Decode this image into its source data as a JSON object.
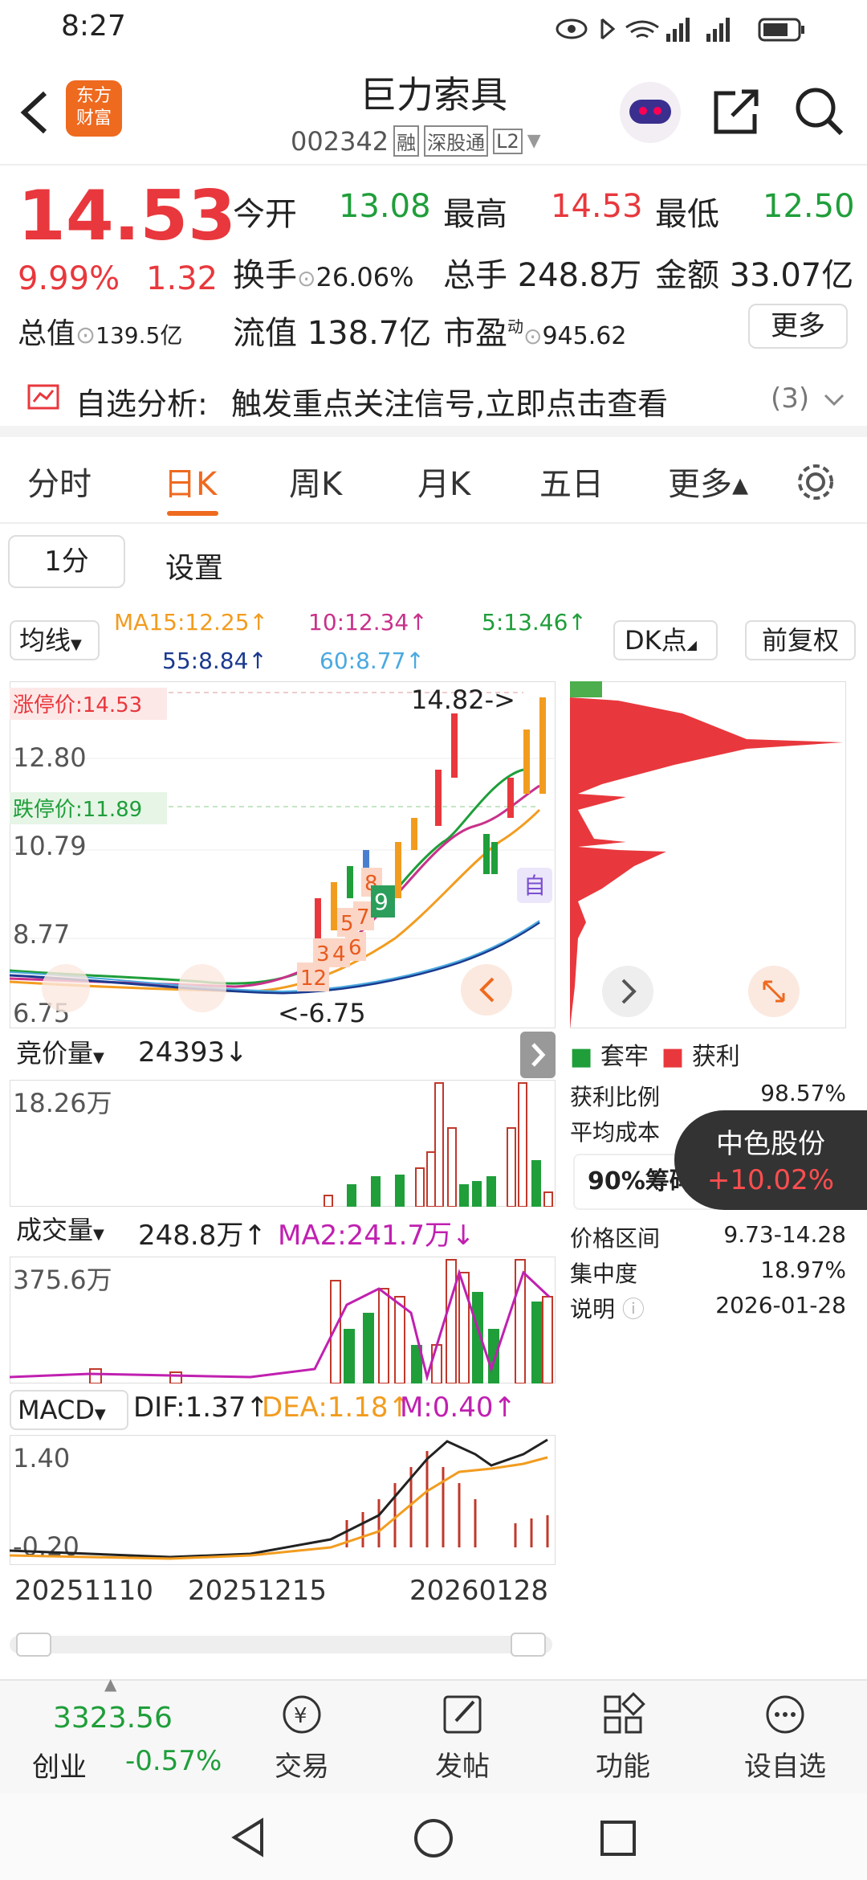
{
  "status": {
    "time": "8:27"
  },
  "header": {
    "logo": "东方\n财富",
    "title": "巨力索具",
    "code": "002342",
    "tags": [
      "融",
      "深股通",
      "L2"
    ]
  },
  "quote": {
    "price": "14.53",
    "pct": "9.99%",
    "chg": "1.32",
    "open_label": "今开",
    "open": "13.08",
    "high_label": "最高",
    "high": "14.53",
    "low_label": "最低",
    "low": "12.50",
    "turn_label": "换手",
    "turn": "26.06%",
    "vol_label": "总手",
    "vol": "248.8万",
    "amt_label": "金额",
    "amt": "33.07亿",
    "cap_label": "总值",
    "cap": "139.5亿",
    "flt_label": "流值",
    "flt": "138.7亿",
    "pe_label": "市盈",
    "pe_sup": "动",
    "pe": "945.62",
    "more": "更多"
  },
  "banner": {
    "title": "自选分析:",
    "text": "触发重点关注信号,立即点击查看",
    "count": "(3)"
  },
  "tabs": [
    "分时",
    "日K",
    "周K",
    "月K",
    "五日",
    "更多▴"
  ],
  "subtabs": {
    "period": "1分",
    "settings": "设置"
  },
  "ma": {
    "selector": "均线",
    "ma15": "MA15:12.25↑",
    "ma10": "10:12.34↑",
    "ma5": "5:13.46↑",
    "ma55": "55:8.84↑",
    "ma60": "60:8.77↑",
    "dk": "DK点",
    "fq": "前复权"
  },
  "kline": {
    "limit_up": "涨停价:14.53",
    "limit_down": "跌停价:11.89",
    "y_labels": [
      "12.80",
      "10.79",
      "8.77",
      "6.75"
    ],
    "hi_label": "14.82->",
    "lo_label": "<-6.75",
    "self_tag": "自",
    "signals": [
      "12",
      "3",
      "4",
      "5",
      "6",
      "7",
      "8",
      "9"
    ]
  },
  "chip": {
    "legend_trap": "套牢",
    "legend_profit": "获利",
    "profit_ratio_label": "获利比例",
    "profit_ratio": "98.57%",
    "avg_cost_label": "平均成本",
    "chip90": "90%筹码",
    "range_label": "价格区间",
    "range": "9.73-14.28",
    "conc_label": "集中度",
    "conc": "18.97%",
    "note_label": "说明",
    "note": "2026-01-28"
  },
  "toast": {
    "name": "中色股份",
    "pct": "+10.02%"
  },
  "auction": {
    "label": "竞价量",
    "value": "24393↓",
    "y": "18.26万"
  },
  "volume": {
    "label": "成交量",
    "value": "248.8万↑",
    "ma2": "MA2:241.7万↓",
    "y": "375.6万"
  },
  "macd": {
    "label": "MACD",
    "dif": "DIF:1.37↑",
    "dea": "DEA:1.18↑",
    "m": "M:0.40↑",
    "y_top": "1.40",
    "y_bot": "-0.20"
  },
  "dates": [
    "20251110",
    "20251215",
    "20260128"
  ],
  "bottom": {
    "index_value": "3323.56",
    "index_name": "创业",
    "index_pct": "-0.57%",
    "items": [
      "交易",
      "发帖",
      "功能",
      "设自选"
    ]
  },
  "colors": {
    "up": "#e8383d",
    "down": "#1f9e3a",
    "orange": "#f29c1f",
    "accent": "#ee6a1f"
  }
}
